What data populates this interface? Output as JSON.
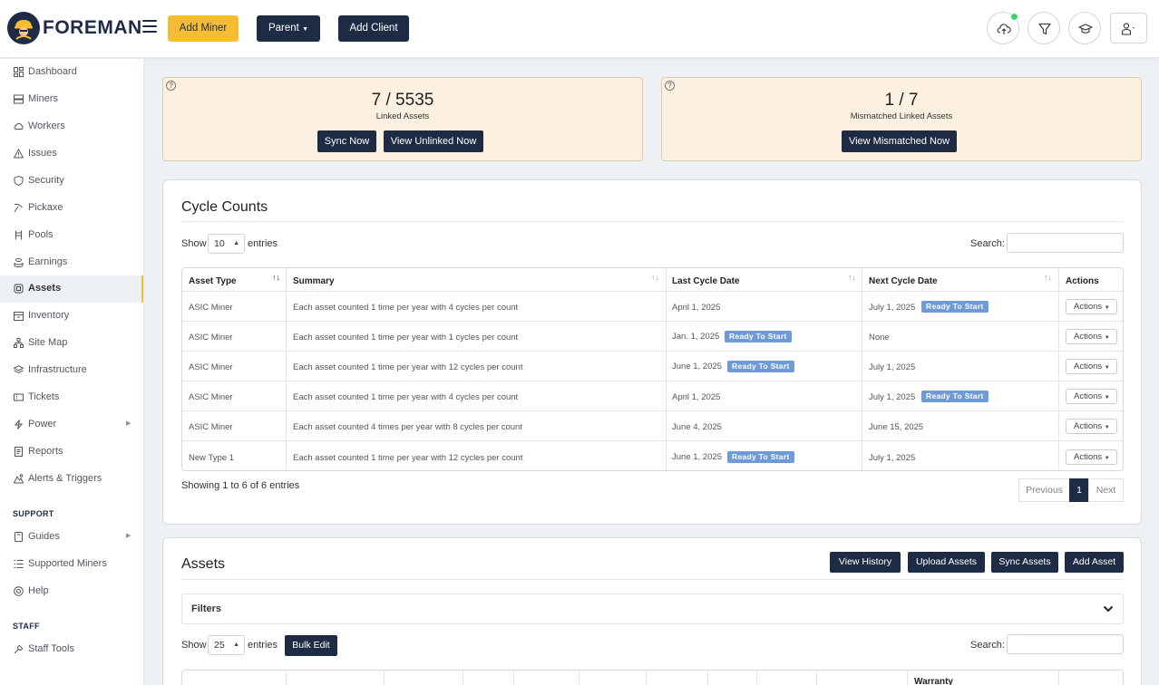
{
  "header": {
    "brand": "FOREMAN",
    "add_miner": "Add Miner",
    "parent": "Parent",
    "add_client": "Add Client"
  },
  "sidebar": {
    "items": [
      {
        "label": "Dashboard",
        "icon": "dashboard-icon"
      },
      {
        "label": "Miners",
        "icon": "server-icon"
      },
      {
        "label": "Workers",
        "icon": "cloud-icon"
      },
      {
        "label": "Issues",
        "icon": "warning-icon"
      },
      {
        "label": "Security",
        "icon": "shield-icon"
      },
      {
        "label": "Pickaxe",
        "icon": "pickaxe-icon"
      },
      {
        "label": "Pools",
        "icon": "pools-icon"
      },
      {
        "label": "Earnings",
        "icon": "coins-icon"
      },
      {
        "label": "Assets",
        "icon": "asset-icon"
      },
      {
        "label": "Inventory",
        "icon": "box-icon"
      },
      {
        "label": "Site Map",
        "icon": "sitemap-icon"
      },
      {
        "label": "Infrastructure",
        "icon": "layers-icon"
      },
      {
        "label": "Tickets",
        "icon": "ticket-icon"
      },
      {
        "label": "Power",
        "icon": "bolt-icon"
      },
      {
        "label": "Reports",
        "icon": "report-icon"
      },
      {
        "label": "Alerts & Triggers",
        "icon": "alert-icon"
      }
    ],
    "support_label": "SUPPORT",
    "support_items": [
      {
        "label": "Guides",
        "icon": "guide-icon"
      },
      {
        "label": "Supported Miners",
        "icon": "list-icon"
      },
      {
        "label": "Help",
        "icon": "help-icon"
      }
    ],
    "staff_label": "STAFF",
    "staff_items": [
      {
        "label": "Staff Tools",
        "icon": "tools-icon"
      }
    ]
  },
  "linked": {
    "value": "7 / 5535",
    "label": "Linked Assets",
    "sync_now": "Sync Now",
    "view_unlinked": "View Unlinked Now"
  },
  "mismatched": {
    "value": "1 / 7",
    "label": "Mismatched Linked Assets",
    "view_mismatched": "View Mismatched Now"
  },
  "cycle": {
    "title": "Cycle Counts",
    "show": "Show",
    "entries_value": "10",
    "entries": "entries",
    "search": "Search:",
    "columns": [
      "Asset Type",
      "Summary",
      "Last Cycle Date",
      "Next Cycle Date",
      "Actions"
    ],
    "rows": [
      {
        "type": "ASIC Miner",
        "summary": "Each asset counted 1 time per year with 4 cycles per count",
        "last": "April 1, 2025",
        "last_badge": "",
        "next": "July 1, 2025",
        "next_badge": "Ready To Start",
        "action": "Actions"
      },
      {
        "type": "ASIC Miner",
        "summary": "Each asset counted 1 time per year with 1 cycles per count",
        "last": "Jan. 1, 2025",
        "last_badge": "Ready To Start",
        "next": "None",
        "next_badge": "",
        "action": "Actions"
      },
      {
        "type": "ASIC Miner",
        "summary": "Each asset counted 1 time per year with 12 cycles per count",
        "last": "June 1, 2025",
        "last_badge": "Ready To Start",
        "next": "July 1, 2025",
        "next_badge": "",
        "action": "Actions"
      },
      {
        "type": "ASIC Miner",
        "summary": "Each asset counted 1 time per year with 4 cycles per count",
        "last": "April 1, 2025",
        "last_badge": "",
        "next": "July 1, 2025",
        "next_badge": "Ready To Start",
        "action": "Actions"
      },
      {
        "type": "ASIC Miner",
        "summary": "Each asset counted 4 times per year with 8 cycles per count",
        "last": "June 4, 2025",
        "last_badge": "",
        "next": "June 15, 2025",
        "next_badge": "",
        "action": "Actions"
      },
      {
        "type": "New Type 1",
        "summary": "Each asset counted 1 time per year with 12 cycles per count",
        "last": "June 1, 2025",
        "last_badge": "Ready To Start",
        "next": "July 1, 2025",
        "next_badge": "",
        "action": "Actions"
      }
    ],
    "showing": "Showing 1 to 6 of 6 entries",
    "previous": "Previous",
    "page": "1",
    "next": "Next"
  },
  "assets": {
    "title": "Assets",
    "view_history": "View History",
    "upload_assets": "Upload Assets",
    "sync_assets": "Sync Assets",
    "add_asset": "Add Asset",
    "filters": "Filters",
    "show": "Show",
    "entries_value": "25",
    "entries": "entries",
    "bulk_edit": "Bulk Edit",
    "search": "Search:",
    "warranty_header": "Warranty"
  },
  "colors": {
    "navy": "#1e2b45",
    "yellow": "#f5bd33",
    "card_bg": "#fcf1e1",
    "badge": "#6e9ad8"
  }
}
